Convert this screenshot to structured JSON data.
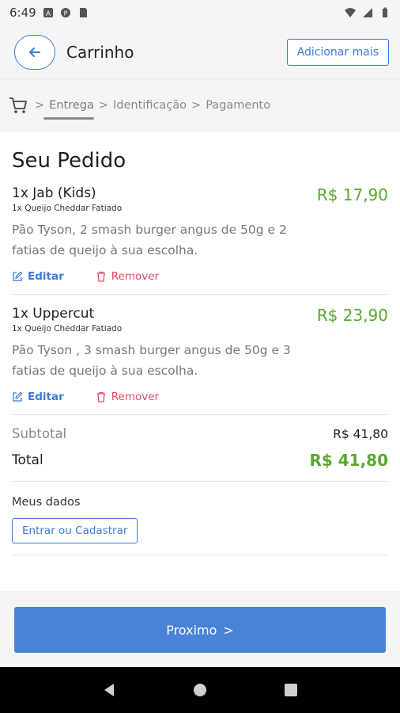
{
  "status_bar": {
    "time": "6:49"
  },
  "header": {
    "title": "Carrinho",
    "add_more_label": "Adicionar mais"
  },
  "steps": {
    "items": [
      "Entrega",
      "Identificação",
      "Pagamento"
    ],
    "separator": ">"
  },
  "order": {
    "section_title": "Seu Pedido",
    "items": [
      {
        "name": "1x Jab (Kids)",
        "option": "1x Queijo Cheddar Fatiado",
        "description": "Pão Tyson, 2 smash burger angus de 50g e 2 fatias de queijo à sua escolha.",
        "price": "R$ 17,90",
        "edit_label": "Editar",
        "remove_label": "Remover"
      },
      {
        "name": "1x Uppercut",
        "option": "1x Queijo Cheddar Fatiado",
        "description": "Pão Tyson , 3 smash burger angus de 50g e 3 fatias de queijo à sua escolha.",
        "price": "R$ 23,90",
        "edit_label": "Editar",
        "remove_label": "Remover"
      }
    ],
    "subtotal_label": "Subtotal",
    "subtotal_value": "R$ 41,80",
    "total_label": "Total",
    "total_value": "R$ 41,80"
  },
  "user_data": {
    "label": "Meus dados",
    "login_button": "Entrar ou Cadastrar"
  },
  "footer": {
    "next_label": "Proximo",
    "next_chevron": ">"
  },
  "colors": {
    "accent": "#3b7bd4",
    "price": "#5aa830",
    "remove": "#e44c64",
    "primary_button": "#4a82d7"
  },
  "icons": [
    "back-arrow-icon",
    "cart-icon",
    "edit-icon",
    "trash-icon",
    "wifi-icon",
    "signal-icon",
    "battery-icon"
  ]
}
